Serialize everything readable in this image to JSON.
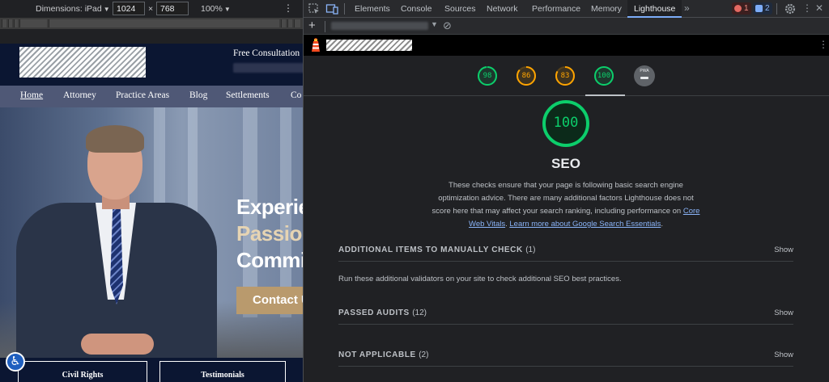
{
  "device_toolbar": {
    "dimensions_label": "Dimensions: iPad",
    "width": "1024",
    "times": "×",
    "height": "768",
    "zoom": "100%"
  },
  "site": {
    "free_consultation": "Free Consultation",
    "nav": [
      "Home",
      "Attorney",
      "Practice Areas",
      "Blog",
      "Settlements",
      "Co"
    ],
    "hero_lines": [
      "Experien",
      "Passion",
      "Commit"
    ],
    "contact_button": "Contact Us",
    "bottom_tabs": [
      "Civil Rights",
      "Testimonials"
    ]
  },
  "devtools": {
    "tabs": [
      "Elements",
      "Console",
      "Sources",
      "Network",
      "Performance",
      "Memory",
      "Lighthouse"
    ],
    "active_tab": "Lighthouse",
    "error_count": "1",
    "message_count": "2"
  },
  "lighthouse": {
    "gauges": [
      {
        "score": 98,
        "color": "#0cce6b"
      },
      {
        "score": 86,
        "color": "#ffa400"
      },
      {
        "score": 83,
        "color": "#ffa400"
      },
      {
        "score": 100,
        "color": "#0cce6b"
      }
    ],
    "pwa_label": "PWA",
    "category": {
      "score": 100,
      "color": "#0cce6b",
      "title": "SEO",
      "description": "These checks ensure that your page is following basic search engine optimization advice. There are many additional factors Lighthouse does not score here that may affect your search ranking, including performance on ",
      "link1": "Core Web Vitals",
      "between": ". ",
      "link2": "Learn more about Google Search Essentials",
      "end": "."
    },
    "sections": {
      "manual": {
        "title": "ADDITIONAL ITEMS TO MANUALLY CHECK",
        "count": "(1)",
        "show": "Show",
        "description": "Run these additional validators on your site to check additional SEO best practices."
      },
      "passed": {
        "title": "PASSED AUDITS",
        "count": "(12)",
        "show": "Show"
      },
      "not_applicable": {
        "title": "NOT APPLICABLE",
        "count": "(2)",
        "show": "Show"
      }
    }
  }
}
